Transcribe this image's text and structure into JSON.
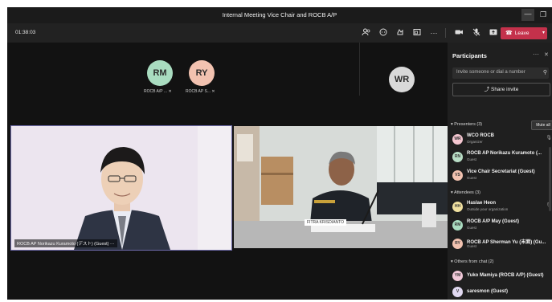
{
  "window": {
    "title": "Internal Meeting Vice Chair and ROCB A/P",
    "minimize_icon": "minimize-icon",
    "maximize_icon": "maximize-icon"
  },
  "toolbar": {
    "timer": "01:38:03",
    "icons": [
      "participants-icon",
      "chat-icon",
      "reactions-icon",
      "rooms-icon",
      "more-icon",
      "camera-icon",
      "mic-off-icon",
      "share-icon"
    ],
    "leave_label": "Leave",
    "leave_color": "#c4314b"
  },
  "stage": {
    "avatars": [
      {
        "initials": "RM",
        "label": "ROCB A/P ...",
        "color": "#a9dcc0"
      },
      {
        "initials": "RY",
        "label": "ROCB AP S...",
        "color": "#f2c2b0"
      },
      {
        "initials": "WR",
        "label": "",
        "color": "#d9d9d9"
      }
    ],
    "videos": [
      {
        "name": "ROCB AP Norikazu Kuramoto (デスト) (Guest) ···"
      },
      {
        "name": "FITRA KRISDIANTO"
      }
    ]
  },
  "panel": {
    "title": "Participants",
    "invite_placeholder": "Invite someone or dial a number",
    "share_invite": "Share invite",
    "presenters_header": "Presenters (3)",
    "mute_all": "Mute all",
    "presenters": [
      {
        "initials": "WR",
        "name": "WCO ROCB",
        "role": "Organizer",
        "color": "#f4c6d0"
      },
      {
        "initials": "RN",
        "name": "ROCB AP Norikazu Kuramoto (...",
        "role": "Guest",
        "color": "#b9dec6"
      },
      {
        "initials": "VS",
        "name": "Vice Chair Secretariat (Guest)",
        "role": "Guest",
        "color": "#f2c2b0"
      }
    ],
    "attendees_header": "Attendees (3)",
    "attendees": [
      {
        "initials": "HH",
        "name": "Haslae Heon",
        "role": "Outside your organization",
        "color": "#f0e0a0"
      },
      {
        "initials": "RM",
        "name": "ROCB A/P May (Guest)",
        "role": "Guest",
        "color": "#a9dcc0"
      },
      {
        "initials": "RY",
        "name": "ROCB AP Sherman Yu (末面) (Gu...",
        "role": "Guest",
        "color": "#f2c2b0"
      }
    ],
    "others_header": "Others from chat (2)",
    "others": [
      {
        "initials": "YM",
        "name": "Yuko Mamiya (ROCB A/P) (Guest)",
        "role": "",
        "color": "#f0c8d8"
      },
      {
        "initials": "V",
        "name": "saresmon (Guest)",
        "role": "",
        "color": "#e0d8f0"
      }
    ]
  }
}
